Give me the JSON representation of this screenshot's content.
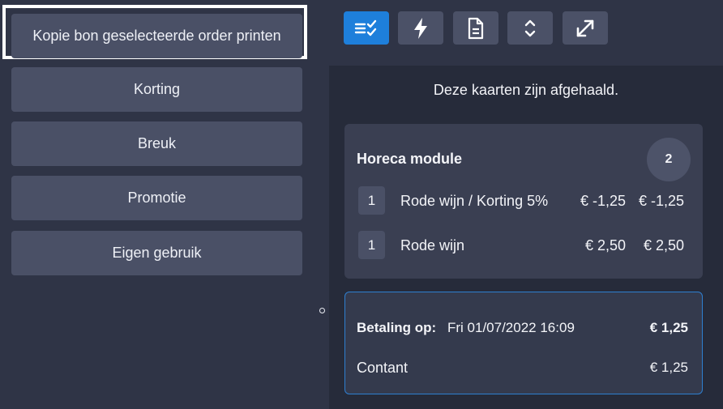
{
  "left_menu": {
    "items": [
      "Kopie bon geselecteerde order printen",
      "Korting",
      "Breuk",
      "Promotie",
      "Eigen gebruik"
    ]
  },
  "toolbar": {
    "buttons": [
      {
        "icon": "checklist-icon",
        "active": true
      },
      {
        "icon": "lightning-icon",
        "active": false
      },
      {
        "icon": "document-icon",
        "active": false
      },
      {
        "icon": "expand-collapse-icon",
        "active": false
      },
      {
        "icon": "fullscreen-icon",
        "active": false
      }
    ],
    "active_color": "#1e7fdb"
  },
  "panel": {
    "message": "Deze kaarten zijn afgehaald.",
    "card": {
      "title": "Horeca module",
      "count": "2",
      "rows": [
        {
          "qty": "1",
          "name": "Rode wijn / Korting 5%",
          "unit_price": "€ -1,25",
          "total": "€ -1,25"
        },
        {
          "qty": "1",
          "name": "Rode wijn",
          "unit_price": "€ 2,50",
          "total": "€ 2,50"
        }
      ]
    },
    "payment": {
      "label": "Betaling op:",
      "datetime": "Fri 01/07/2022 16:09",
      "total": "€ 1,25",
      "method": "Contant",
      "amount": "€ 1,25"
    }
  }
}
